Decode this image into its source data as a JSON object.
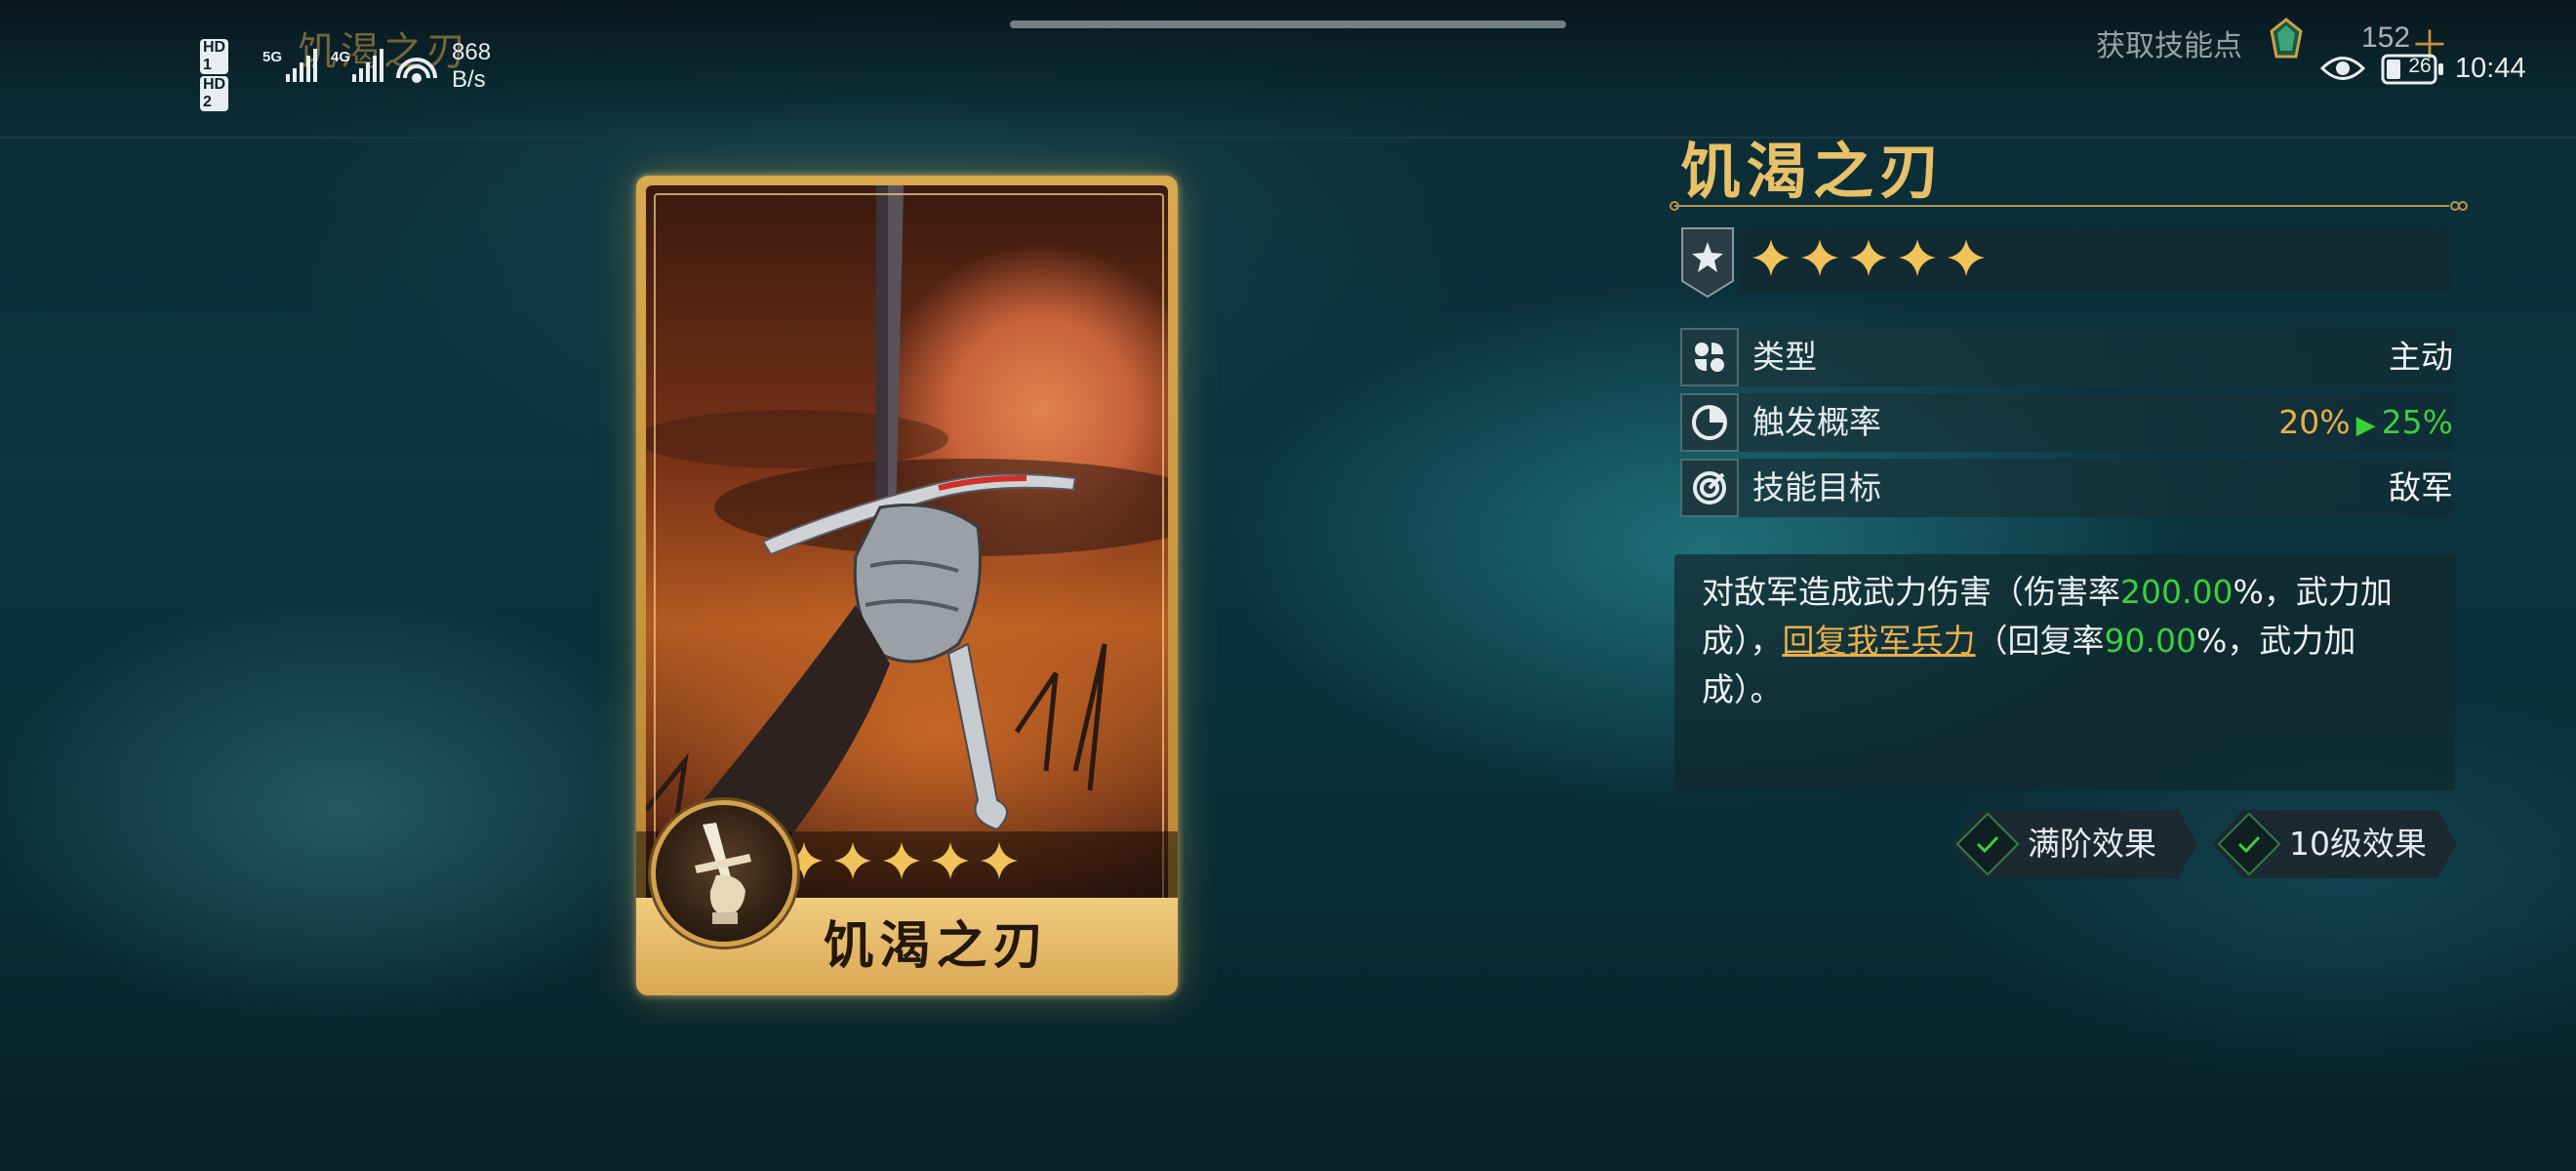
{
  "status_bar": {
    "sim1": "HD 1",
    "sim2": "HD 2",
    "net1": "5G",
    "net2": "4G",
    "speed_value": "868",
    "speed_unit": "B/s",
    "battery": "26",
    "time": "10:44"
  },
  "header": {
    "ghost_title": "饥渴之刃",
    "skill_points_label": "获取技能点",
    "skill_points_value": "152",
    "plus_icon": "plus-icon",
    "gem_icon": "green-gem-icon"
  },
  "card": {
    "name": "饥渴之刃",
    "stars": 5,
    "emblem_icon": "fist-sword-icon"
  },
  "detail": {
    "title": "饥渴之刃",
    "stars": 5,
    "rows": [
      {
        "icon": "type-icon",
        "label": "类型",
        "value": "主动"
      },
      {
        "icon": "probability-icon",
        "label": "触发概率",
        "value_old": "20%",
        "value_new": "25%"
      },
      {
        "icon": "target-icon",
        "label": "技能目标",
        "value": "敌军"
      }
    ],
    "description": {
      "p1": "对敌军造成武力伤害（伤害率",
      "dmg_rate": "200.00",
      "p2": "%，武力加成），",
      "link": "回复我军兵力",
      "p3": "（回复率",
      "heal_rate": "90.00",
      "p4": "%，武力加成）。"
    }
  },
  "buttons": {
    "max_effect": "满阶效果",
    "lv10_effect": "10级效果"
  },
  "colors": {
    "gold": "#e8c068",
    "green": "#3ccf3c",
    "orange": "#e8b04a",
    "bg": "#0b3540"
  }
}
